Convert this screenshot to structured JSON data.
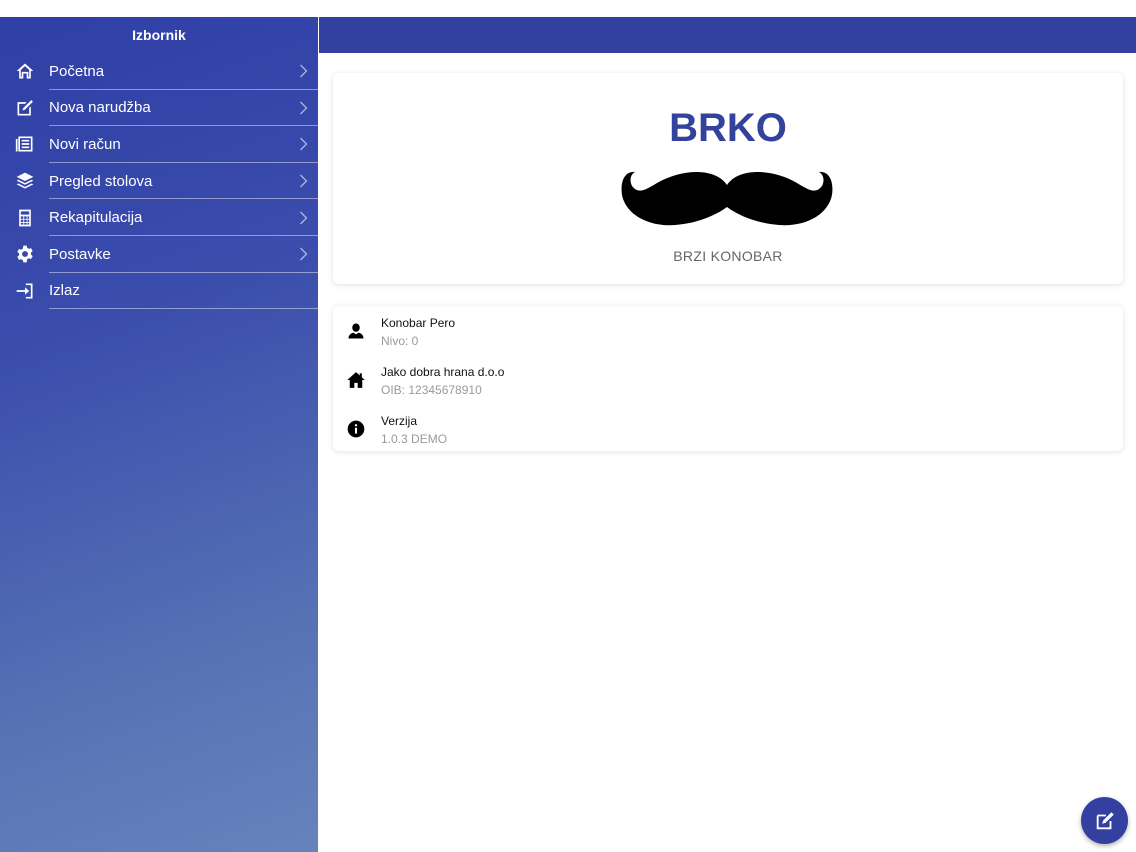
{
  "sidebar": {
    "title": "Izbornik",
    "items": [
      {
        "label": "Početna",
        "icon": "home-icon",
        "chevron": true
      },
      {
        "label": "Nova narudžba",
        "icon": "edit-icon",
        "chevron": true
      },
      {
        "label": "Novi račun",
        "icon": "receipt-icon",
        "chevron": true
      },
      {
        "label": "Pregled stolova",
        "icon": "layers-icon",
        "chevron": true
      },
      {
        "label": "Rekapitulacija",
        "icon": "calculator-icon",
        "chevron": true
      },
      {
        "label": "Postavke",
        "icon": "gear-icon",
        "chevron": true
      },
      {
        "label": "Izlaz",
        "icon": "exit-icon",
        "chevron": false
      }
    ]
  },
  "brand": {
    "title": "BRKO",
    "subtitle": "BRZI KONOBAR",
    "logo_icon": "mustache-icon"
  },
  "info": {
    "user": {
      "title": "Konobar Pero",
      "subtitle": "Nivo: 0",
      "icon": "user-icon"
    },
    "company": {
      "title": "Jako dobra hrana d.o.o",
      "subtitle": "OIB: 12345678910",
      "icon": "home-icon"
    },
    "version": {
      "title": "Verzija",
      "subtitle": "1.0.3 DEMO",
      "icon": "info-icon"
    }
  },
  "fab": {
    "icon": "edit-icon"
  },
  "colors": {
    "accent": "#3440a0",
    "brand_title": "#33429b",
    "sidebar_gradient_start": "#2f3fa6",
    "sidebar_gradient_end": "#6683bd"
  }
}
